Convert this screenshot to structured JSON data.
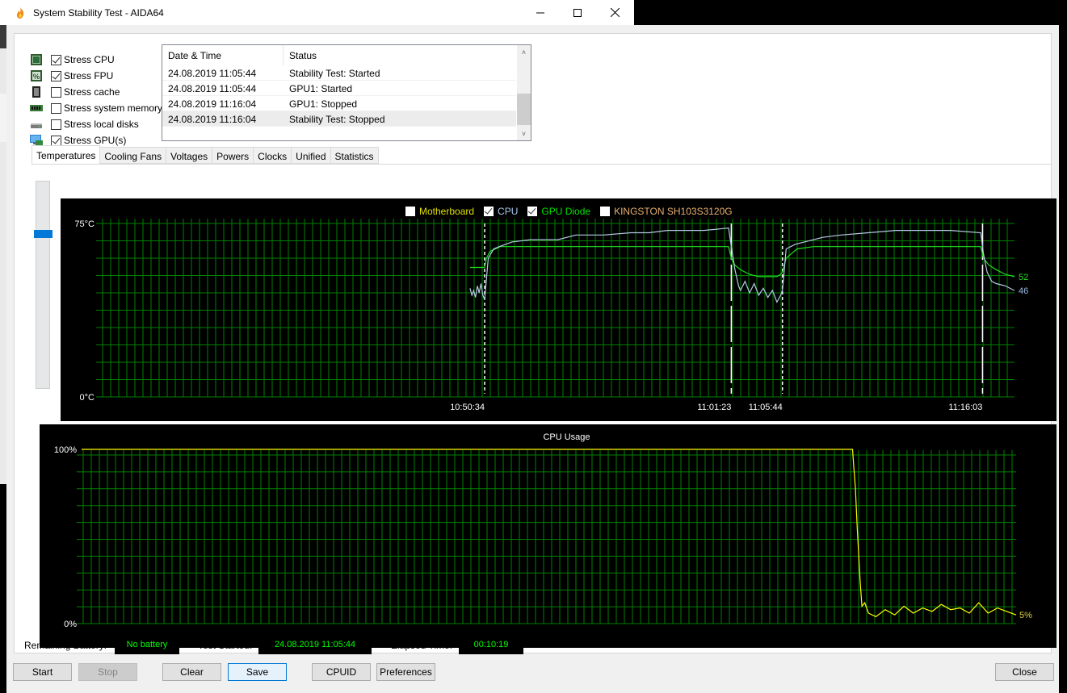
{
  "window": {
    "title": "System Stability Test - AIDA64",
    "controls": {
      "minimize": "minimize",
      "maximize": "maximize",
      "close": "close"
    }
  },
  "stress_options": [
    {
      "label": "Stress CPU",
      "checked": true,
      "icon": "cpu-chip-icon"
    },
    {
      "label": "Stress FPU",
      "checked": true,
      "icon": "fpu-chip-icon"
    },
    {
      "label": "Stress cache",
      "checked": false,
      "icon": "cache-chip-icon"
    },
    {
      "label": "Stress system memory",
      "checked": false,
      "icon": "memory-module-icon"
    },
    {
      "label": "Stress local disks",
      "checked": false,
      "icon": "hard-disk-icon"
    },
    {
      "label": "Stress GPU(s)",
      "checked": true,
      "icon": "gpu-card-icon"
    }
  ],
  "log": {
    "columns": [
      "Date & Time",
      "Status"
    ],
    "rows": [
      {
        "datetime": "24.08.2019 11:05:44",
        "status": "Stability Test: Started"
      },
      {
        "datetime": "24.08.2019 11:05:44",
        "status": "GPU1: Started"
      },
      {
        "datetime": "24.08.2019 11:16:04",
        "status": "GPU1: Stopped"
      },
      {
        "datetime": "24.08.2019 11:16:04",
        "status": "Stability Test: Stopped"
      }
    ],
    "selected_row": 3
  },
  "tabs": [
    {
      "label": "Temperatures",
      "active": true
    },
    {
      "label": "Cooling Fans",
      "active": false
    },
    {
      "label": "Voltages",
      "active": false
    },
    {
      "label": "Powers",
      "active": false
    },
    {
      "label": "Clocks",
      "active": false
    },
    {
      "label": "Unified",
      "active": false
    },
    {
      "label": "Statistics",
      "active": false
    }
  ],
  "colors": {
    "grid": "#008000",
    "cpu_series": "#b0c8e8",
    "gpu_series": "#00e000",
    "motherboard": "#e0e000",
    "kingston": "#e8b070",
    "cpu_usage": "#ffff00",
    "status_text": "#00ff00",
    "accent": "#0078d7"
  },
  "chart_data": [
    {
      "type": "line",
      "title": "Temperatures",
      "legend": [
        {
          "name": "Motherboard",
          "checked": false,
          "color": "#e0e000"
        },
        {
          "name": "CPU",
          "checked": true,
          "color": "#a8c8f0"
        },
        {
          "name": "GPU Diode",
          "checked": true,
          "color": "#00e000"
        },
        {
          "name": "KINGSTON SH103S3120G",
          "checked": false,
          "color": "#e8b070"
        }
      ],
      "legend_position": "top-center",
      "ylim": [
        0,
        75
      ],
      "ytick_labels": [
        "75°C",
        "0°C"
      ],
      "y_divisions": 10,
      "grid": true,
      "x_range_fraction": [
        0,
        1
      ],
      "time_markers": [
        {
          "label": "10:50:34",
          "x_fraction": 0.42,
          "style": "dashed"
        },
        {
          "label": "11:01:23",
          "x_fraction": 0.69,
          "style": "long-dash"
        },
        {
          "label": "11:05:44",
          "x_fraction": 0.746,
          "style": "dashed"
        },
        {
          "label": "11:16:03",
          "x_fraction": 0.965,
          "style": "long-dash"
        }
      ],
      "series": [
        {
          "name": "GPU Diode",
          "end_label": "52",
          "points": [
            [
              0.404,
              56
            ],
            [
              0.42,
              56
            ],
            [
              0.422,
              60
            ],
            [
              0.426,
              63
            ],
            [
              0.432,
              64
            ],
            [
              0.437,
              65
            ],
            [
              0.46,
              65
            ],
            [
              0.52,
              65
            ],
            [
              0.6,
              65
            ],
            [
              0.66,
              65
            ],
            [
              0.687,
              65
            ],
            [
              0.69,
              60
            ],
            [
              0.694,
              57
            ],
            [
              0.7,
              55
            ],
            [
              0.71,
              53
            ],
            [
              0.72,
              52
            ],
            [
              0.74,
              52
            ],
            [
              0.744,
              53
            ],
            [
              0.746,
              54
            ],
            [
              0.75,
              60
            ],
            [
              0.756,
              62
            ],
            [
              0.762,
              64
            ],
            [
              0.78,
              65
            ],
            [
              0.8,
              65
            ],
            [
              0.85,
              65
            ],
            [
              0.9,
              65
            ],
            [
              0.93,
              65
            ],
            [
              0.963,
              65
            ],
            [
              0.966,
              60
            ],
            [
              0.972,
              57
            ],
            [
              0.98,
              55
            ],
            [
              0.99,
              53
            ],
            [
              1.0,
              52
            ]
          ]
        },
        {
          "name": "CPU",
          "end_label": "46",
          "points": [
            [
              0.404,
              47
            ],
            [
              0.406,
              44
            ],
            [
              0.408,
              46
            ],
            [
              0.41,
              43
            ],
            [
              0.412,
              48
            ],
            [
              0.414,
              45
            ],
            [
              0.416,
              49
            ],
            [
              0.418,
              44
            ],
            [
              0.42,
              42
            ],
            [
              0.424,
              60
            ],
            [
              0.43,
              64
            ],
            [
              0.436,
              65
            ],
            [
              0.45,
              67
            ],
            [
              0.47,
              68
            ],
            [
              0.5,
              68
            ],
            [
              0.52,
              70
            ],
            [
              0.55,
              70
            ],
            [
              0.58,
              71
            ],
            [
              0.6,
              71
            ],
            [
              0.62,
              72
            ],
            [
              0.66,
              72
            ],
            [
              0.687,
              73
            ],
            [
              0.69,
              65
            ],
            [
              0.694,
              55
            ],
            [
              0.698,
              48
            ],
            [
              0.7,
              46
            ],
            [
              0.705,
              50
            ],
            [
              0.71,
              45
            ],
            [
              0.715,
              49
            ],
            [
              0.72,
              44
            ],
            [
              0.725,
              47
            ],
            [
              0.73,
              43
            ],
            [
              0.735,
              46
            ],
            [
              0.74,
              41
            ],
            [
              0.744,
              44
            ],
            [
              0.746,
              46
            ],
            [
              0.75,
              64
            ],
            [
              0.76,
              66
            ],
            [
              0.77,
              67
            ],
            [
              0.79,
              69
            ],
            [
              0.81,
              70
            ],
            [
              0.84,
              71
            ],
            [
              0.87,
              72
            ],
            [
              0.9,
              72
            ],
            [
              0.93,
              72
            ],
            [
              0.963,
              71
            ],
            [
              0.966,
              62
            ],
            [
              0.97,
              54
            ],
            [
              0.975,
              50
            ],
            [
              0.98,
              49
            ],
            [
              0.99,
              48
            ],
            [
              1.0,
              46
            ]
          ]
        }
      ]
    },
    {
      "type": "line",
      "title": "CPU Usage",
      "ylim": [
        0,
        100
      ],
      "ytick_labels": [
        "100%",
        "0%"
      ],
      "y_divisions": 10,
      "grid": true,
      "series": [
        {
          "name": "CPU Usage",
          "end_label": "5%",
          "points": [
            [
              0,
              100
            ],
            [
              0.825,
              100
            ],
            [
              0.826,
              92
            ],
            [
              0.828,
              78
            ],
            [
              0.83,
              55
            ],
            [
              0.833,
              25
            ],
            [
              0.835,
              10
            ],
            [
              0.838,
              12
            ],
            [
              0.842,
              6
            ],
            [
              0.85,
              4
            ],
            [
              0.86,
              8
            ],
            [
              0.87,
              5
            ],
            [
              0.88,
              10
            ],
            [
              0.89,
              6
            ],
            [
              0.9,
              9
            ],
            [
              0.91,
              7
            ],
            [
              0.92,
              11
            ],
            [
              0.93,
              8
            ],
            [
              0.94,
              9
            ],
            [
              0.95,
              6
            ],
            [
              0.96,
              12
            ],
            [
              0.97,
              6
            ],
            [
              0.98,
              9
            ],
            [
              0.99,
              7
            ],
            [
              1.0,
              5
            ]
          ]
        }
      ]
    }
  ],
  "status": {
    "battery_label": "Remaining Battery:",
    "battery_value": "No battery",
    "started_label": "Test Started:",
    "started_value": "24.08.2019 11:05:44",
    "elapsed_label": "Elapsed Time:",
    "elapsed_value": "00:10:19"
  },
  "buttons": {
    "start": "Start",
    "stop": "Stop",
    "clear": "Clear",
    "save": "Save",
    "cpuid": "CPUID",
    "preferences": "Preferences",
    "close": "Close"
  },
  "slider_level_fraction": 0.25
}
